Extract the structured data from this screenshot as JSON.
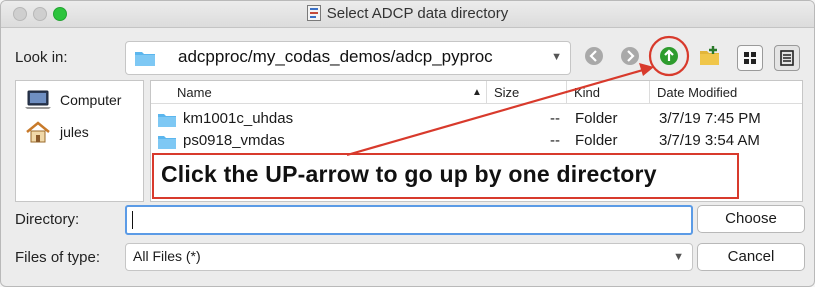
{
  "window": {
    "title": "Select ADCP data directory"
  },
  "toolbar": {
    "look_in_label": "Look in:",
    "look_in_path": "adcpproc/my_codas_demos/adcp_pyproc",
    "back_icon": "back-arrow-icon",
    "forward_icon": "forward-arrow-icon",
    "up_icon": "up-arrow-icon",
    "new_folder_icon": "new-folder-icon",
    "list_view_icon": "list-view-icon",
    "detail_view_icon": "detail-view-icon",
    "up_button_color": "#2e9c2e",
    "highlight_color": "#d83a2c"
  },
  "sidebar": {
    "items": [
      {
        "label": "Computer",
        "icon": "computer-icon"
      },
      {
        "label": "jules",
        "icon": "home-icon"
      }
    ]
  },
  "file_table": {
    "columns": [
      "Name",
      "Size",
      "Kind",
      "Date Modified"
    ],
    "sort_indicator": "▲",
    "rows": [
      {
        "name": "km1001c_uhdas",
        "size": "--",
        "kind": "Folder",
        "date": "3/7/19 7:45 PM"
      },
      {
        "name": "ps0918_vmdas",
        "size": "--",
        "kind": "Folder",
        "date": "3/7/19 3:54 AM"
      }
    ]
  },
  "annotation": {
    "text": "Click the UP-arrow to go up by one directory"
  },
  "form": {
    "directory_label": "Directory:",
    "directory_value": "",
    "choose_label": "Choose",
    "files_of_type_label": "Files of type:",
    "files_of_type_value": "All Files (*)",
    "cancel_label": "Cancel"
  }
}
